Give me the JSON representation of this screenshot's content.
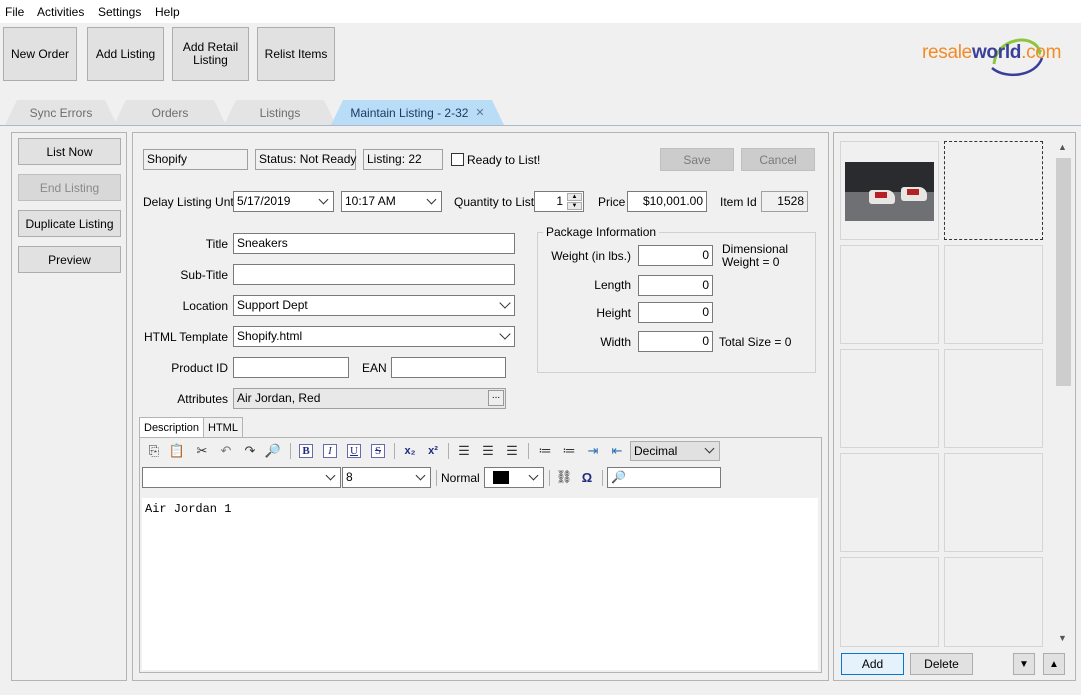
{
  "menu": [
    "File",
    "Activities",
    "Settings",
    "Help"
  ],
  "toolbar": {
    "new_order": "New Order",
    "add_listing": "Add Listing",
    "add_retail_1": "Add Retail",
    "add_retail_2": "Listing",
    "relist": "Relist Items"
  },
  "logo": {
    "resale": "resale",
    "world": "world",
    "com": ".com"
  },
  "tabs": {
    "sync_errors": "Sync Errors",
    "orders": "Orders",
    "listings": "Listings",
    "maintain": "Maintain Listing - 2-32",
    "close": "✕"
  },
  "side_buttons": {
    "list_now": "List Now",
    "end_listing": "End Listing",
    "duplicate": "Duplicate Listing",
    "preview": "Preview"
  },
  "header": {
    "channel": "Shopify",
    "status": "Status: Not Ready",
    "listing": "Listing: 22",
    "ready_label": "Ready to List!",
    "ready_checked": false,
    "save": "Save",
    "cancel": "Cancel"
  },
  "schedule": {
    "delay_label": "Delay Listing Until",
    "date": "5/17/2019",
    "time": "10:17 AM",
    "qty_label": "Quantity to List",
    "qty": "1",
    "price_label": "Price",
    "price": "$10,001.00",
    "item_id_label": "Item Id",
    "item_id": "1528"
  },
  "form": {
    "title_label": "Title",
    "title": "Sneakers",
    "subtitle_label": "Sub-Title",
    "subtitle": "",
    "location_label": "Location",
    "location": "Support Dept",
    "template_label": "HTML Template",
    "template": "Shopify.html",
    "product_id_label": "Product ID",
    "product_id": "",
    "ean_label": "EAN",
    "ean": "",
    "attributes_label": "Attributes",
    "attributes": "Air Jordan, Red",
    "attributes_btn": "..."
  },
  "package": {
    "legend": "Package Information",
    "weight_label": "Weight (in lbs.)",
    "weight": "0",
    "dimensional_1": "Dimensional",
    "dimensional_2": "Weight = 0",
    "length_label": "Length",
    "length": "0",
    "height_label": "Height",
    "height": "0",
    "width_label": "Width",
    "width": "0",
    "total_size": "Total Size = 0"
  },
  "editor": {
    "tab_description": "Description",
    "tab_html": "HTML",
    "list_style": "Decimal",
    "font": "",
    "size": "8",
    "paragraph": "Normal",
    "color": "#000000",
    "find": "",
    "content": "Air Jordan 1"
  },
  "images": {
    "add": "Add",
    "delete": "Delete"
  }
}
